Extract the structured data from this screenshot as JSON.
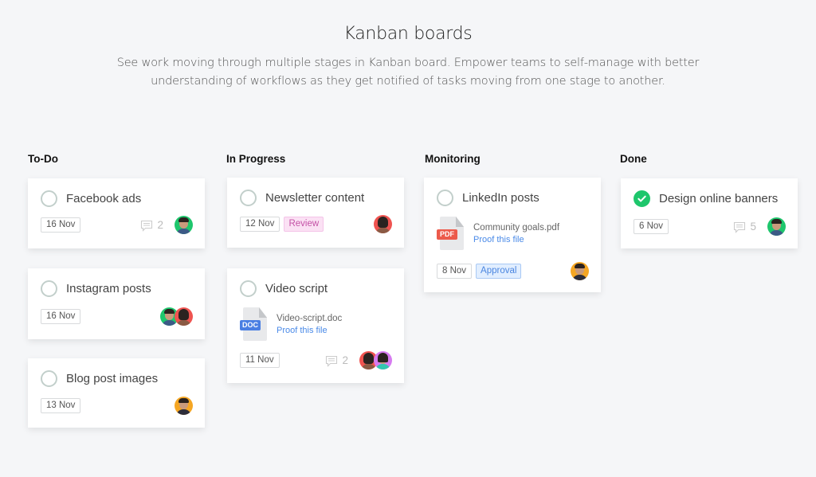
{
  "header": {
    "title": "Kanban boards",
    "description": "See work moving through multiple stages in Kanban board. Empower teams to self-manage with better understanding of workflows as they get notified of tasks moving from one stage to another."
  },
  "colors": {
    "done_check": "#1ec66c",
    "review_tag": "#c451a6",
    "approval_tag": "#4b86e0",
    "doc_badge": "#4a7fe3",
    "pdf_badge": "#ec5a4b",
    "link": "#4a8ae8"
  },
  "columns": [
    {
      "title": "To-Do",
      "cards": [
        {
          "title": "Facebook ads",
          "done": false,
          "date": "16 Nov",
          "comments": "2",
          "avatars": [
            "green-avatar"
          ]
        },
        {
          "title": "Instagram posts",
          "done": false,
          "date": "16 Nov",
          "avatars": [
            "green-avatar",
            "red-avatar"
          ]
        },
        {
          "title": "Blog post images",
          "done": false,
          "date": "13 Nov",
          "avatars": [
            "orange-avatar"
          ]
        }
      ]
    },
    {
      "title": "In Progress",
      "cards": [
        {
          "title": "Newsletter content",
          "done": false,
          "date": "12 Nov",
          "tag": "Review",
          "avatars": [
            "red-avatar"
          ]
        },
        {
          "title": "Video script",
          "done": false,
          "file": {
            "type": "DOC",
            "name": "Video-script.doc",
            "action": "Proof this file"
          },
          "date": "11 Nov",
          "comments": "2",
          "avatars": [
            "red-avatar",
            "purple-avatar"
          ]
        }
      ]
    },
    {
      "title": "Monitoring",
      "cards": [
        {
          "title": "LinkedIn posts",
          "done": false,
          "file": {
            "type": "PDF",
            "name": "Community goals.pdf",
            "action": "Proof this file"
          },
          "date": "8 Nov",
          "tag": "Approval",
          "avatars": [
            "orange-avatar"
          ]
        }
      ]
    },
    {
      "title": "Done",
      "cards": [
        {
          "title": "Design online banners",
          "done": true,
          "date": "6 Nov",
          "comments": "5",
          "avatars": [
            "green-avatar"
          ]
        }
      ]
    }
  ]
}
